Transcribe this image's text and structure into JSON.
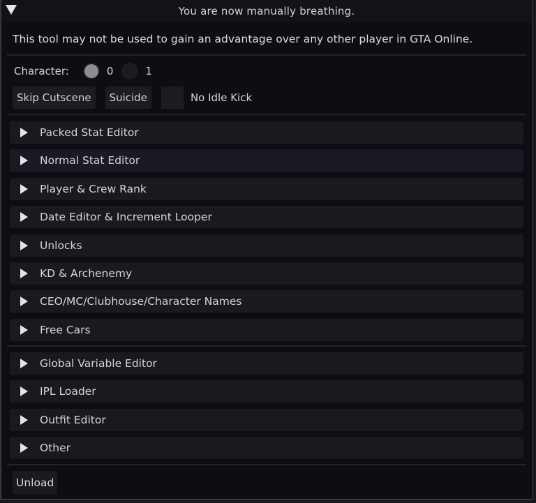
{
  "window": {
    "title": "You are now manually breathing.",
    "collapse_icon": "triangle-down-icon"
  },
  "disclaimer": "This tool may not be used to gain an advantage over any other player in GTA Online.",
  "character": {
    "label": "Character:",
    "options": [
      {
        "label": "0",
        "selected": true
      },
      {
        "label": "1",
        "selected": false
      }
    ]
  },
  "actions": {
    "skip_cutscene": "Skip Cutscene",
    "suicide": "Suicide",
    "no_idle_kick": {
      "label": "No Idle Kick",
      "checked": false
    }
  },
  "sections_group1": [
    {
      "label": "Packed Stat Editor"
    },
    {
      "label": "Normal Stat Editor"
    },
    {
      "label": "Player & Crew Rank"
    },
    {
      "label": "Date Editor & Increment Looper"
    },
    {
      "label": "Unlocks"
    },
    {
      "label": "KD & Archenemy"
    },
    {
      "label": "CEO/MC/Clubhouse/Character Names"
    },
    {
      "label": "Free Cars"
    }
  ],
  "sections_group2": [
    {
      "label": "Global Variable Editor"
    },
    {
      "label": "IPL Loader"
    },
    {
      "label": "Outfit Editor"
    },
    {
      "label": "Other"
    }
  ],
  "footer": {
    "unload": "Unload"
  },
  "colors": {
    "window_bg": "#0f0d11",
    "header_bg": "#1b191e",
    "text": "#d6d4d8"
  }
}
